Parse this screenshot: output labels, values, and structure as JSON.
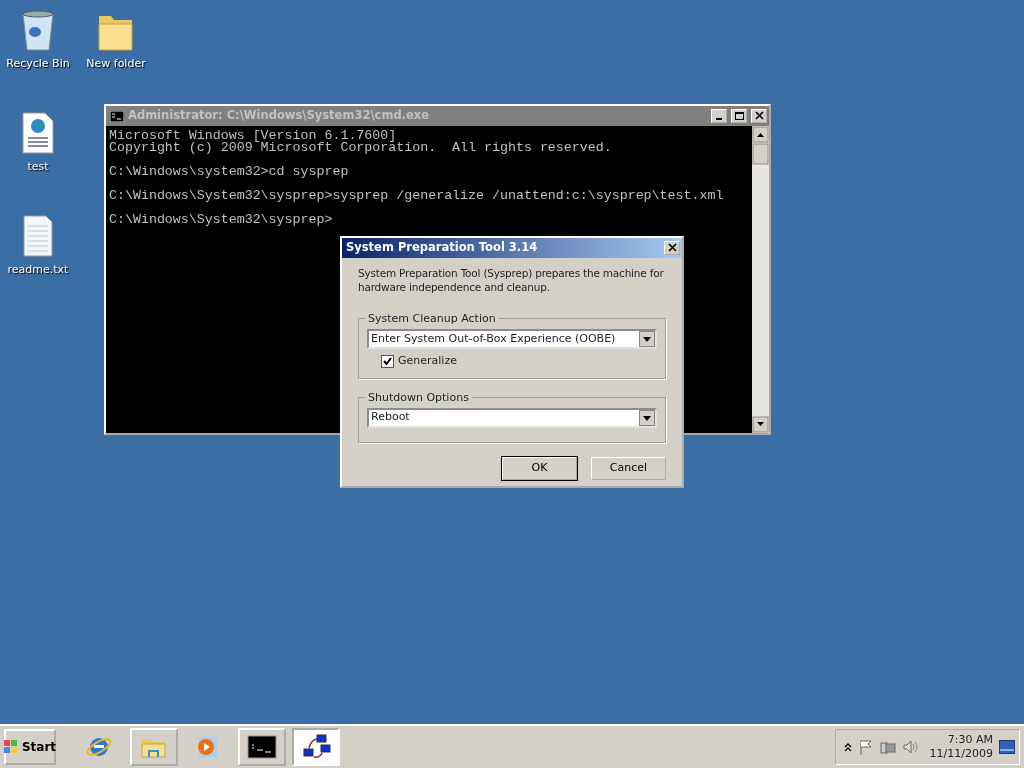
{
  "desktop_icons": [
    {
      "label": "Recycle Bin",
      "kind": "recycle"
    },
    {
      "label": "New folder",
      "kind": "folder"
    },
    {
      "label": "test",
      "kind": "web"
    },
    {
      "label": "readme.txt",
      "kind": "text"
    }
  ],
  "console_window": {
    "title": "Administrator: C:\\Windows\\System32\\cmd.exe",
    "blocks": [
      [
        "Microsoft Windows [Version 6.1.7600]",
        "Copyright (c) 2009 Microsoft Corporation.  All rights reserved."
      ],
      [
        "C:\\Windows\\system32>cd sysprep"
      ],
      [
        "C:\\Windows\\System32\\sysprep>sysprep /generalize /unattend:c:\\sysprep\\test.xml"
      ],
      [
        "C:\\Windows\\System32\\sysprep>"
      ]
    ]
  },
  "dialog": {
    "title": "System Preparation Tool 3.14",
    "description": "System Preparation Tool (Sysprep) prepares the machine for hardware independence and cleanup.",
    "groups": [
      {
        "legend": "System Cleanup Action",
        "value": "Enter System Out-of-Box Experience (OOBE)",
        "checkbox": {
          "label": "Generalize",
          "checked": true
        }
      },
      {
        "legend": "Shutdown Options",
        "value": "Reboot"
      }
    ],
    "buttons": [
      {
        "label": "OK",
        "default": true
      },
      {
        "label": "Cancel",
        "default": false
      }
    ]
  },
  "taskbar": {
    "start_label": "Start",
    "apps": [
      {
        "kind": "browser",
        "selected": false
      },
      {
        "kind": "explorer",
        "selected": false
      },
      {
        "kind": "media",
        "selected": false
      },
      {
        "kind": "console",
        "selected": false
      },
      {
        "kind": "network",
        "selected": true
      }
    ],
    "time": "7:30 AM",
    "date": "11/11/2009"
  }
}
